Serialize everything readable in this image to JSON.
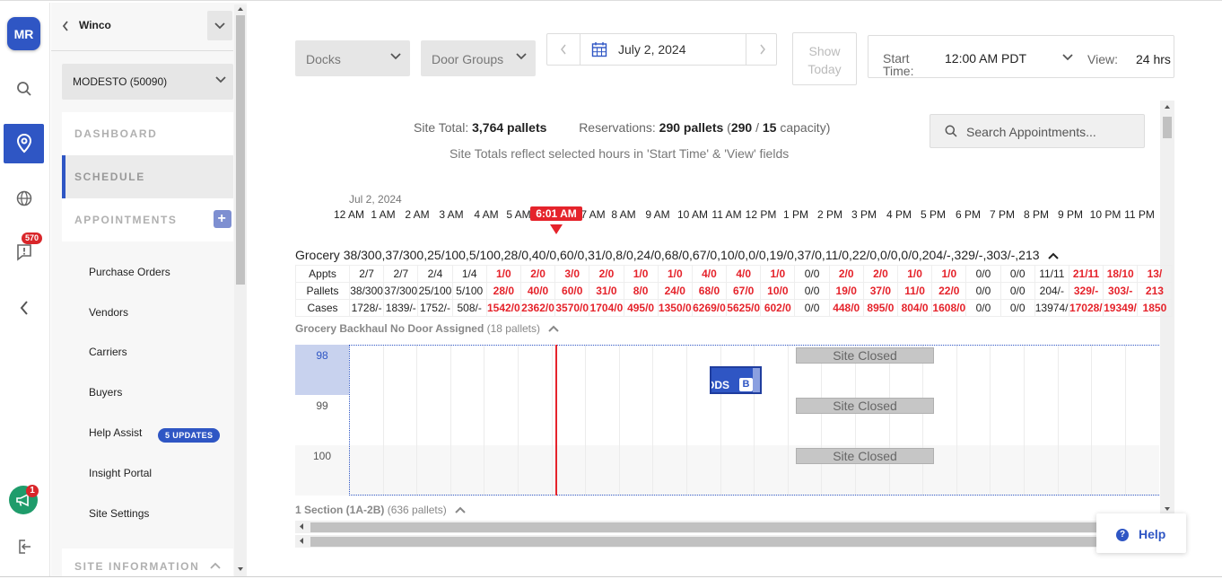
{
  "rail": {
    "avatar_initials": "MR",
    "notifications_count": "570",
    "announcements_count": "1"
  },
  "sidebar": {
    "org": "Winco",
    "site": "MODESTO (50090)",
    "sections": {
      "dashboard": "DASHBOARD",
      "schedule": "SCHEDULE",
      "appointments": "APPOINTMENTS",
      "site_information": "SITE INFORMATION"
    },
    "items": [
      {
        "label": "Purchase Orders"
      },
      {
        "label": "Vendors"
      },
      {
        "label": "Carriers"
      },
      {
        "label": "Buyers"
      },
      {
        "label": "Help Assist"
      },
      {
        "label": "Insight Portal"
      },
      {
        "label": "Site Settings"
      }
    ],
    "help_assist_badge": "5 UPDATES"
  },
  "toolbar": {
    "docks": "Docks",
    "door_groups": "Door Groups",
    "date": "July 2, 2024",
    "show_today": "Show Today",
    "start_time_label": "Start Time:",
    "start_time_value": "12:00 AM PDT",
    "view_label": "View:",
    "view_value": "24 hrs"
  },
  "summary": {
    "site_total_label": "Site Total:",
    "site_total_value": "3,764 pallets",
    "reservations_label": "Reservations:",
    "reservations_value": "290 pallets",
    "capacity_open": "(",
    "capacity_used": "290",
    "capacity_sep": " / ",
    "capacity_total": "15",
    "capacity_suffix": " capacity)",
    "note": "Site Totals reflect selected hours in 'Start Time' & 'View' fields"
  },
  "search": {
    "placeholder": "Search Appointments..."
  },
  "timeline": {
    "date": "Jul 2, 2024",
    "hours": [
      "12 AM",
      "1 AM",
      "2 AM",
      "3 AM",
      "4 AM",
      "5 AM",
      "7 AM",
      "8 AM",
      "9 AM",
      "10 AM",
      "11 AM",
      "12 PM",
      "1 PM",
      "2 PM",
      "3 PM",
      "4 PM",
      "5 PM",
      "6 PM",
      "7 PM",
      "8 PM",
      "9 PM",
      "10 PM",
      "11 PM"
    ],
    "now_label": "6:01 AM"
  },
  "group": {
    "name": "Grocery",
    "pallets": [
      "38/300",
      "37/300",
      "25/100",
      "5/100",
      "28/0",
      "40/0",
      "60/0",
      "31/0",
      "8/0",
      "24/0",
      "68/0",
      "67/0",
      "10/0",
      "0/0",
      "19/0",
      "37/0",
      "11/0",
      "22/0",
      "0/0",
      "0/0",
      "204/-",
      "329/-",
      "303/-",
      "213"
    ],
    "row_labels": [
      "Appts",
      "Pallets",
      "Cases"
    ],
    "appts": [
      "2/7",
      "2/7",
      "2/4",
      "1/4",
      "1/0",
      "2/0",
      "3/0",
      "2/0",
      "1/0",
      "1/0",
      "4/0",
      "4/0",
      "1/0",
      "0/0",
      "2/0",
      "2/0",
      "1/0",
      "1/0",
      "0/0",
      "0/0",
      "11/11",
      "21/11",
      "18/10",
      "13/"
    ],
    "cases": [
      "1728/-",
      "1839/-",
      "1752/-",
      "508/-",
      "1542/0",
      "2362/0",
      "3570/0",
      "1704/0",
      "495/0",
      "1350/0",
      "6269/0",
      "5625/0",
      "602/0",
      "0/0",
      "448/0",
      "895/0",
      "804/0",
      "1608/0",
      "0/0",
      "0/0",
      "13974/-",
      "17028/-",
      "19349/-",
      "1850"
    ],
    "red_columns": [
      4,
      5,
      6,
      7,
      8,
      9,
      10,
      11,
      12,
      14,
      15,
      16,
      17,
      21,
      22,
      23
    ]
  },
  "backhaul": {
    "name": "Grocery Backhaul No Door Assigned",
    "pallets": "(18 pallets)"
  },
  "doors": [
    {
      "label": "98",
      "closed": "Site Closed"
    },
    {
      "label": "99",
      "closed": "Site Closed"
    },
    {
      "label": "100",
      "closed": "Site Closed"
    }
  ],
  "appointment": {
    "text": "ODS",
    "badge": "B"
  },
  "section2": {
    "name": "1 Section (1A-2B)",
    "pallets": "(636 pallets)"
  },
  "help": {
    "label": "Help"
  },
  "colors": {
    "primary": "#2f56c4",
    "alert": "#e5232b",
    "success": "#1f9c6b"
  }
}
